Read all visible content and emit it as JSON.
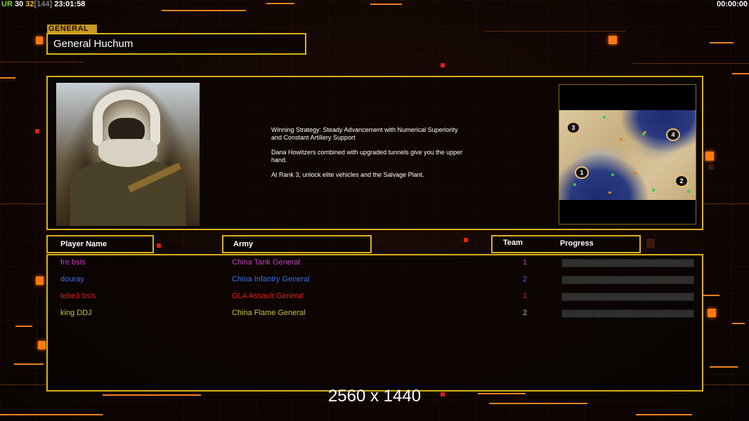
{
  "topbar": {
    "ur": "UR",
    "n1": "30",
    "n2": "32",
    "n3": "[144]",
    "clock": "23:01:58",
    "timer": "00:00:00"
  },
  "general": {
    "tag": "GENERAL",
    "name": "General Huchum",
    "description": [
      "Winning Strategy: Steady Advancement with Numerical Superiority\n and Constant Artillery Support",
      "Dana Howitzers combined with upgraded tunnels give you the upper\n hand.",
      "At Rank 3, unlock elite vehicles and the Salvage Plant."
    ]
  },
  "minimap": {
    "spawns": [
      "1",
      "2",
      "3",
      "4"
    ]
  },
  "headers": {
    "player": "Player Name",
    "army": "Army",
    "team": "Team",
    "progress": "Progress"
  },
  "players": [
    {
      "name": "fre bsis",
      "army": "China Tank General",
      "team": "1",
      "color": "#c040c0",
      "progress": 0
    },
    {
      "name": "douray",
      "army": "China Infantry General",
      "team": "2",
      "color": "#4070e0",
      "progress": 0
    },
    {
      "name": "tebe3 bsis",
      "army": "GLA Assault General",
      "team": "1",
      "color": "#e02020",
      "progress": 0
    },
    {
      "name": "king DDJ",
      "army": "China Flame General",
      "team": "2",
      "color": "#c8c040",
      "progress": 0
    }
  ],
  "resolution": "2560 x 1440"
}
